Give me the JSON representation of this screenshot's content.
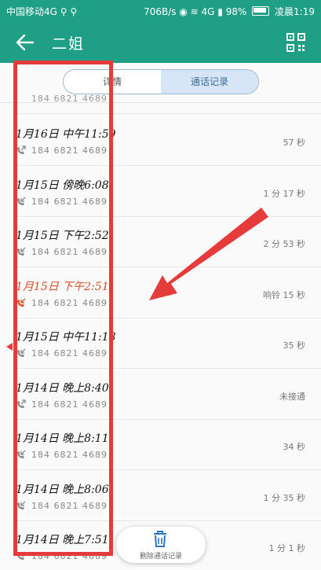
{
  "status_bar": {
    "carrier": "中国移动4G ⚲ ⚲",
    "speed": "706B/s",
    "network": "4G",
    "battery": "98%",
    "time": "凌晨1:19"
  },
  "header": {
    "title": "二姐"
  },
  "tabs": [
    {
      "label": "详情",
      "active": false
    },
    {
      "label": "通话记录",
      "active": true
    }
  ],
  "partial_row": {
    "phone": "184 6821 4689"
  },
  "calls": [
    {
      "time": "1月16日 中午11:59",
      "phone": "184 6821 4689",
      "duration": "57 秒",
      "type": "outgoing",
      "missed": false
    },
    {
      "time": "1月15日 傍晚6:08",
      "phone": "184 6821 4689",
      "duration": "1 分 17 秒",
      "type": "incoming",
      "missed": false
    },
    {
      "time": "1月15日 下午2:52",
      "phone": "184 6821 4689",
      "duration": "2 分 53 秒",
      "type": "incoming",
      "missed": false
    },
    {
      "time": "1月15日 下午2:51",
      "phone": "184 6821 4689",
      "duration": "响铃 15 秒",
      "type": "missed",
      "missed": true
    },
    {
      "time": "1月15日 中午11:18",
      "phone": "184 6821 4689",
      "duration": "35 秒",
      "type": "incoming",
      "missed": false
    },
    {
      "time": "1月14日 晚上8:40",
      "phone": "184 6821 4689",
      "duration": "未接通",
      "type": "outgoing",
      "missed": false
    },
    {
      "time": "1月14日 晚上8:11",
      "phone": "184 6821 4689",
      "duration": "34 秒",
      "type": "incoming",
      "missed": false
    },
    {
      "time": "1月14日 晚上8:06",
      "phone": "184 6821 4689",
      "duration": "1 分 35 秒",
      "type": "incoming",
      "missed": false
    },
    {
      "time": "1月14日 晚上7:51",
      "phone": "184 6821 4689",
      "duration": "1 分 1 秒",
      "type": "incoming",
      "missed": false
    }
  ],
  "delete_button": {
    "label": "删除通话记录"
  },
  "colors": {
    "appbar": "#1f9f86",
    "highlight": "#e53b3b",
    "missed": "#d4502a"
  }
}
